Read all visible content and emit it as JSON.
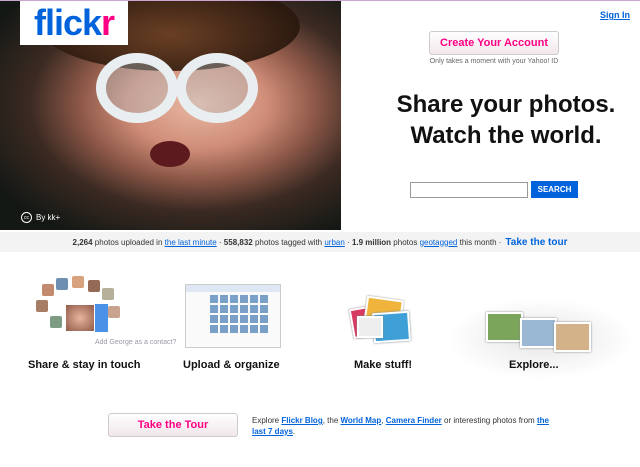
{
  "logo": {
    "part1": "flick",
    "part2": "r"
  },
  "photo_credit": {
    "cc": "cc",
    "text": "By kk+"
  },
  "header": {
    "signin": "Sign In"
  },
  "signup": {
    "button": "Create Your Account",
    "note": "Only takes a moment with your Yahoo! ID"
  },
  "headline": {
    "line1": "Share your photos.",
    "line2": "Watch the world."
  },
  "search": {
    "value": "",
    "button": "SEARCH"
  },
  "stats": {
    "uploaded_count": "2,264",
    "uploaded_text": "photos uploaded in",
    "uploaded_link": "the last minute",
    "tagged_count": "558,832",
    "tagged_text": "photos tagged with",
    "tagged_link": "urban",
    "geo_count": "1.9 million",
    "geo_text": "photos",
    "geo_link": "geotagged",
    "geo_suffix": "this month",
    "tour": "Take the tour"
  },
  "features": [
    {
      "label": "Share & stay in touch",
      "note": "Add George as a contact?"
    },
    {
      "label": "Upload & organize"
    },
    {
      "label": "Make stuff!"
    },
    {
      "label": "Explore..."
    }
  ],
  "bottom": {
    "tour_button": "Take the Tour",
    "explore_prefix": "Explore",
    "link_blog": "Flickr Blog",
    "comma1": ", the",
    "link_map": "World Map",
    "comma2": ",",
    "link_camera": "Camera Finder",
    "middle": "or interesting photos from",
    "link_last7": "the last 7 days",
    "end": "."
  },
  "colors": {
    "blue": "#0063dc",
    "pink": "#ff0084"
  }
}
